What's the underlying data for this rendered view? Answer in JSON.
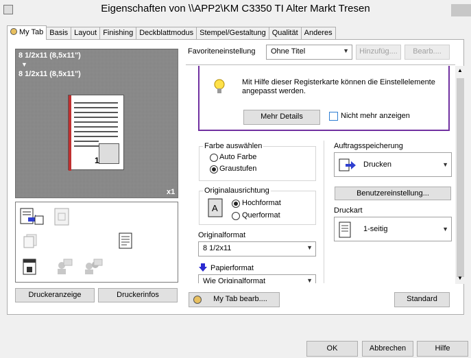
{
  "window": {
    "title": "Eigenschaften von \\\\APP2\\KM C3350 TI Alter Markt Tresen"
  },
  "tabs": [
    "My Tab",
    "Basis",
    "Layout",
    "Finishing",
    "Deckblattmodus",
    "Stempel/Gestaltung",
    "Qualität",
    "Anderes"
  ],
  "preview": {
    "paper_line1": "8 1/2x11 (8,5x11\")",
    "arrow": "▼",
    "paper_line2": "8 1/2x11 (8,5x11\")",
    "copies": "x1",
    "page_number": "1"
  },
  "left_buttons": {
    "printer_view": "Druckeranzeige",
    "printer_info": "Druckerinfos"
  },
  "favorites": {
    "label": "Favoriteneinstellung",
    "value": "Ohne Titel",
    "add": "Hinzufüg....",
    "edit": "Bearb...."
  },
  "info": {
    "text": "Mit Hilfe dieser Registerkarte können die Einstellelemente angepasst werden.",
    "more_details": "Mehr Details",
    "dont_show": "Nicht mehr anzeigen"
  },
  "color": {
    "label": "Farbe auswählen",
    "auto": "Auto Farbe",
    "gray": "Graustufen"
  },
  "orientation": {
    "label": "Originalausrichtung",
    "portrait": "Hochformat",
    "landscape": "Querformat"
  },
  "original_format": {
    "label": "Originalformat",
    "value": "8 1/2x11"
  },
  "paper_format": {
    "label": "Papierformat",
    "value": "Wie Originalformat"
  },
  "job_storage": {
    "label": "Auftragsspeicherung",
    "value": "Drucken"
  },
  "user_setting": "Benutzereinstellung...",
  "print_type": {
    "label": "Druckart",
    "value": "1-seitig"
  },
  "bottom": {
    "mytab_edit": "My Tab bearb....",
    "standard": "Standard"
  },
  "footer": {
    "ok": "OK",
    "cancel": "Abbrechen",
    "help": "Hilfe"
  }
}
